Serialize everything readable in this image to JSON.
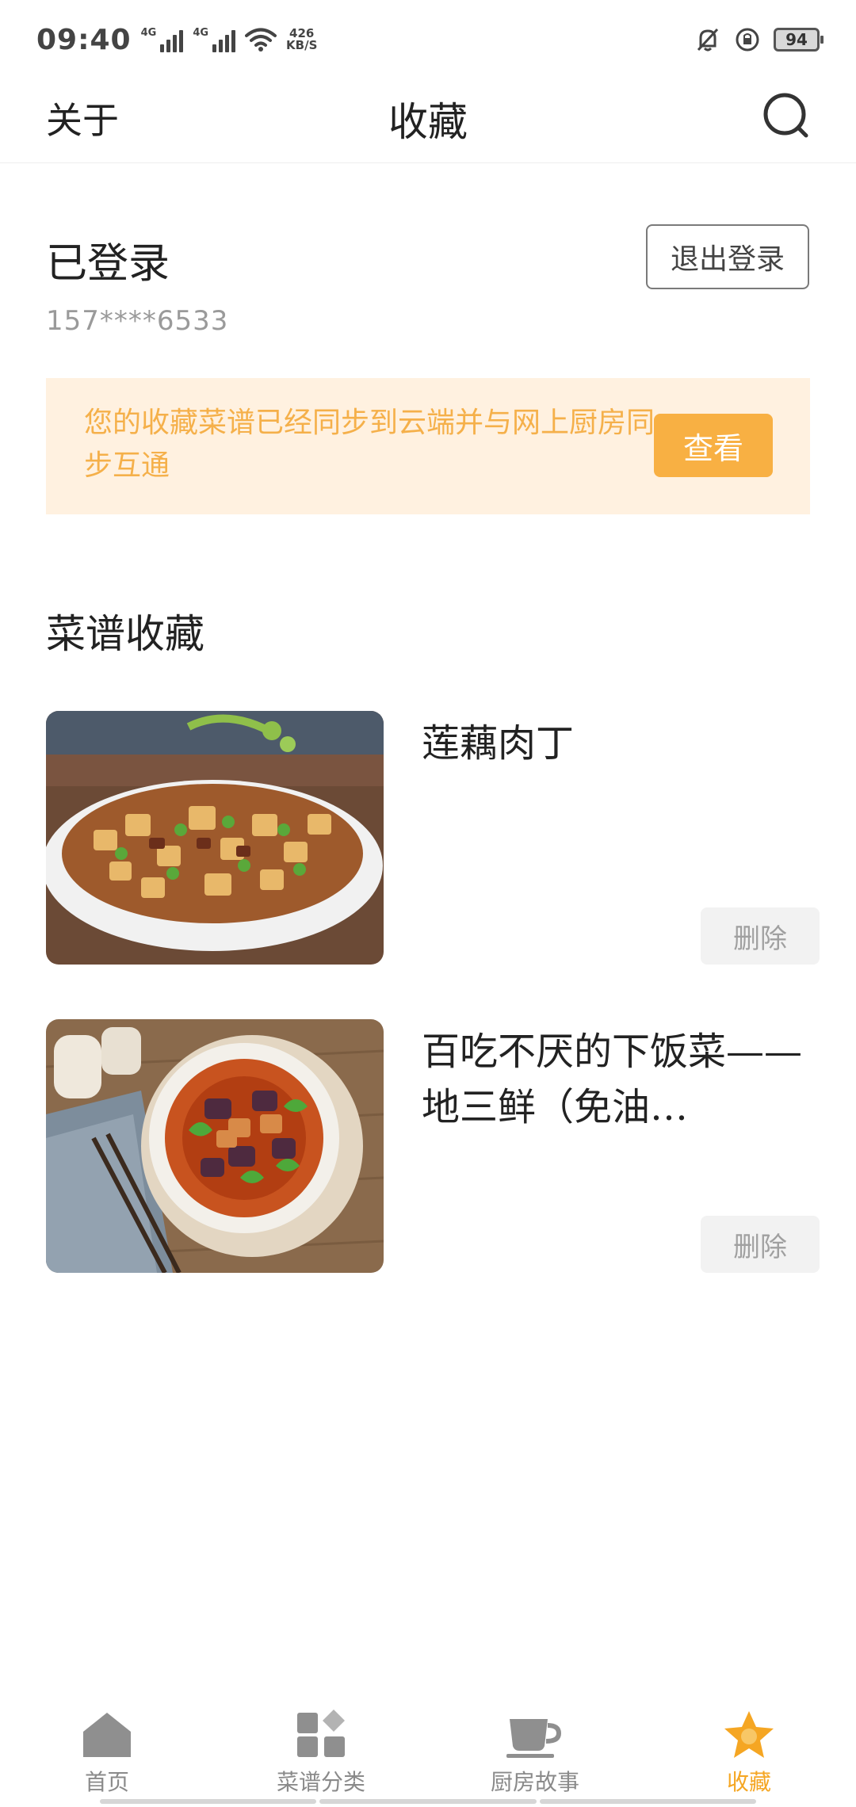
{
  "status_bar": {
    "time": "09:40",
    "signal1_tag": "4G",
    "signal2_tag": "4G",
    "net_speed_value": "426",
    "net_speed_unit": "KB/S",
    "battery": "94"
  },
  "header": {
    "left_link": "关于",
    "title": "收藏",
    "search_icon": "search-icon"
  },
  "account": {
    "status": "已登录",
    "phone": "157****6533",
    "logout_label": "退出登录"
  },
  "sync_banner": {
    "text": "您的收藏菜谱已经同步到云端并与网上厨房同步互通",
    "button_label": "查看"
  },
  "section": {
    "title": "菜谱收藏"
  },
  "recipes": [
    {
      "title": "莲藕肉丁",
      "delete_label": "删除"
    },
    {
      "title": "百吃不厌的下饭菜——地三鲜（免油…",
      "delete_label": "删除"
    }
  ],
  "bottom_nav": [
    {
      "label": "首页",
      "icon": "home-icon",
      "active": false
    },
    {
      "label": "菜谱分类",
      "icon": "category-grid-icon",
      "active": false
    },
    {
      "label": "厨房故事",
      "icon": "cup-icon",
      "active": false
    },
    {
      "label": "收藏",
      "icon": "star-icon",
      "active": true
    }
  ],
  "colors": {
    "accent": "#f8b043",
    "banner_bg": "#fff1e0",
    "banner_text": "#f5b04a",
    "nav_inactive": "#8a8a8a"
  }
}
